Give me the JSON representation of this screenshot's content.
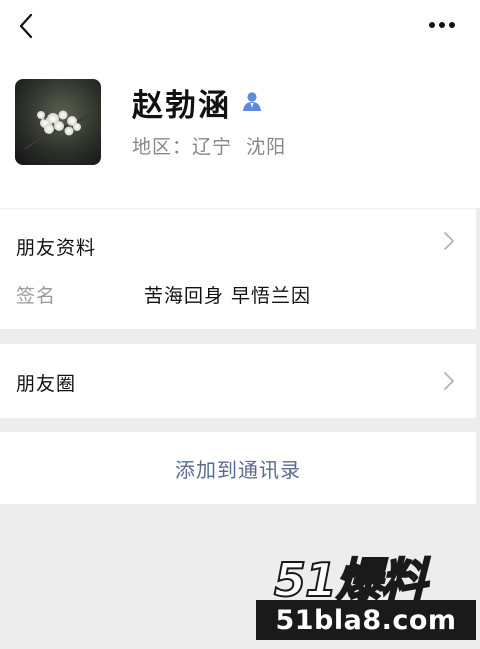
{
  "topbar": {
    "back_icon": "chevron-left-icon",
    "more_icon": "ellipsis-icon"
  },
  "profile": {
    "name": "赵勃涵",
    "name_icon": "user-icon",
    "region": "地区：辽宁  沈阳"
  },
  "info": {
    "title": "朋友资料",
    "signature_label": "签名",
    "signature_value": "苦海回身 早悟兰因"
  },
  "moments": {
    "title": "朋友圈"
  },
  "actions": {
    "add_to_contacts": "添加到通讯录"
  },
  "watermark": {
    "line1": "51爆料",
    "line2": "51bla8.com"
  },
  "colors": {
    "link": "#576b95",
    "icon_blue": "#5b8bd9",
    "background": "#ededed"
  }
}
